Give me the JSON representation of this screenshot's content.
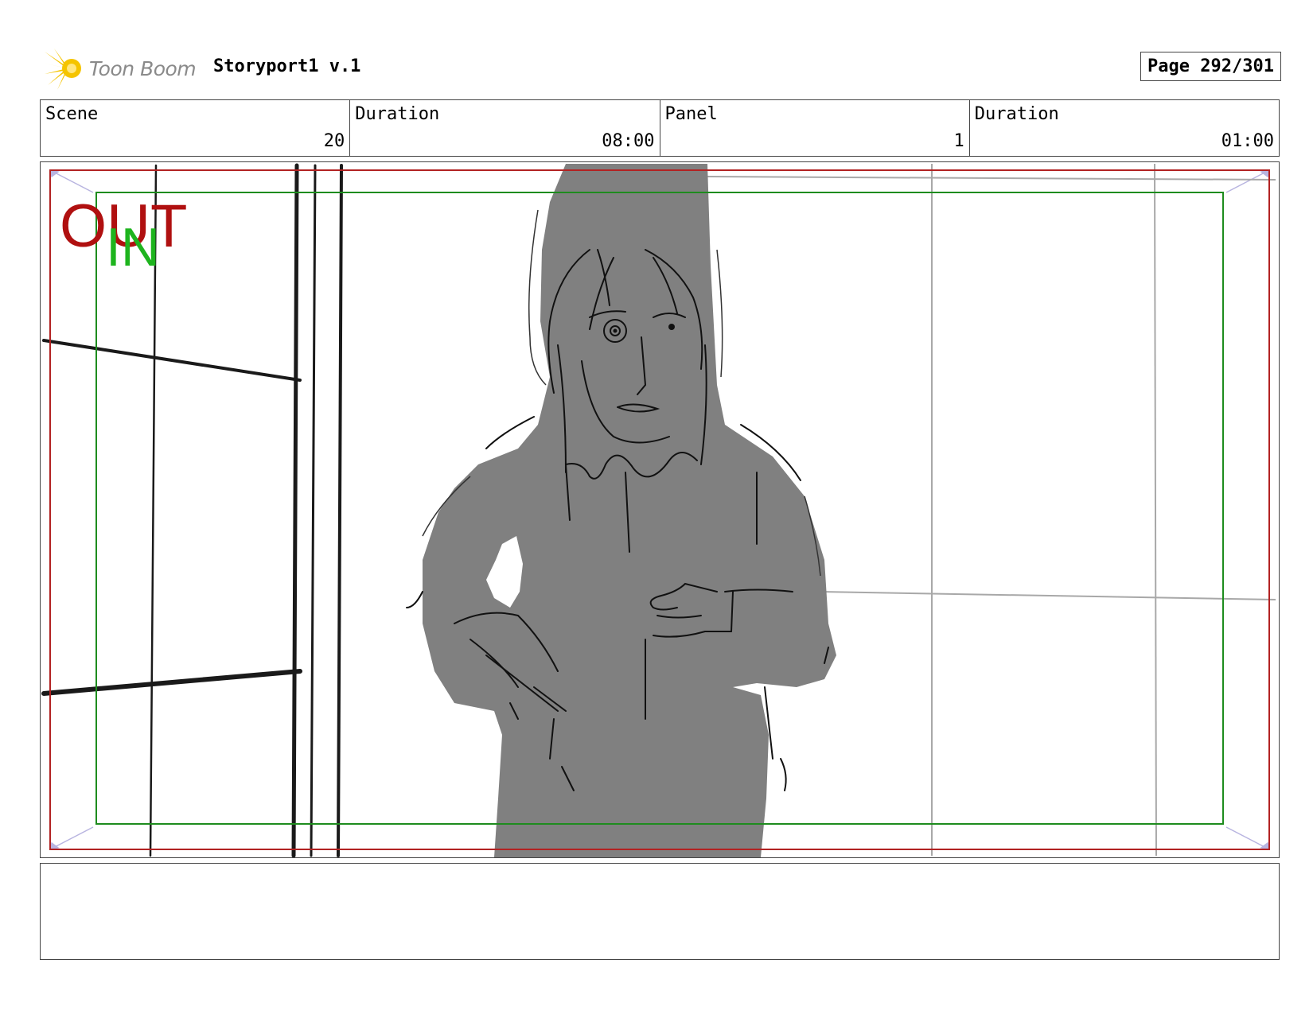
{
  "header": {
    "logo_text": "Toon Boom",
    "project_title": "Storyport1 v.1",
    "page_label": "Page 292/301"
  },
  "info": {
    "scene_label": "Scene",
    "scene_value": "20",
    "scene_duration_label": "Duration",
    "scene_duration_value": "08:00",
    "panel_label": "Panel",
    "panel_value": "1",
    "panel_duration_label": "Duration",
    "panel_duration_value": "01:00"
  },
  "panel": {
    "out_label": "OUT",
    "in_label": "IN",
    "colors": {
      "out_frame": "#b22222",
      "in_frame": "#1e8c1e",
      "character_fill": "#808080",
      "corner_guides": "#b8b4e0"
    }
  },
  "notes": {
    "text": ""
  }
}
